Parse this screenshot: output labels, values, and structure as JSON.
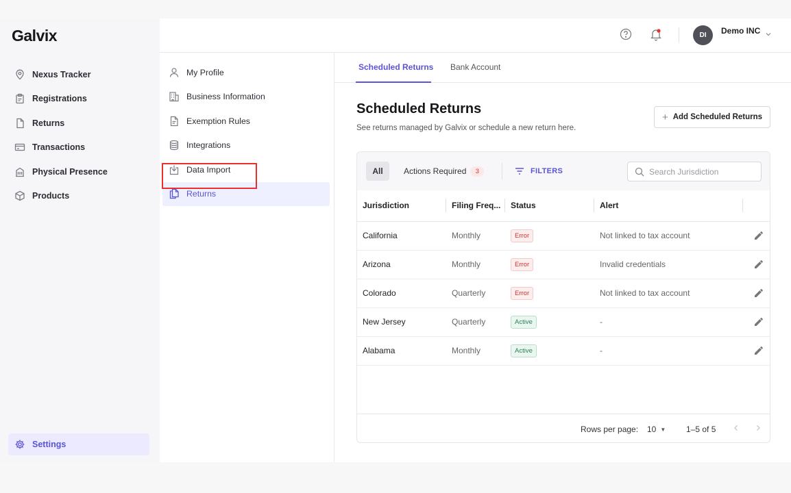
{
  "brand": {
    "name": "Galvix"
  },
  "nav": {
    "items": [
      {
        "label": "Nexus Tracker",
        "icon": "map-pin-icon"
      },
      {
        "label": "Registrations",
        "icon": "clipboard-icon"
      },
      {
        "label": "Returns",
        "icon": "document-icon"
      },
      {
        "label": "Transactions",
        "icon": "credit-card-icon"
      },
      {
        "label": "Physical Presence",
        "icon": "building-icon"
      },
      {
        "label": "Products",
        "icon": "cube-icon"
      }
    ],
    "settings_label": "Settings"
  },
  "topbar": {
    "avatar_initials": "DI",
    "company": "Demo INC"
  },
  "settings_menu": {
    "items": [
      {
        "label": "My Profile",
        "icon": "user-icon"
      },
      {
        "label": "Business Information",
        "icon": "office-icon"
      },
      {
        "label": "Exemption Rules",
        "icon": "file-text-icon"
      },
      {
        "label": "Integrations",
        "icon": "database-icon"
      },
      {
        "label": "Data Import",
        "icon": "import-icon"
      },
      {
        "label": "Returns",
        "icon": "copy-icon"
      }
    ],
    "active_index": 5
  },
  "tabs": [
    "Scheduled Returns",
    "Bank Account"
  ],
  "page": {
    "title": "Scheduled Returns",
    "subtitle": "See returns managed by Galvix or schedule a new return here.",
    "add_button": "Add Scheduled Returns"
  },
  "filters": {
    "all_label": "All",
    "actions_label": "Actions Required",
    "actions_count": "3",
    "filters_label": "FILTERS",
    "search_placeholder": "Search Jurisdiction"
  },
  "table": {
    "columns": [
      "Jurisdiction",
      "Filing Freq...",
      "Status",
      "Alert"
    ],
    "rows": [
      {
        "jurisdiction": "California",
        "frequency": "Monthly",
        "status": "Error",
        "alert": "Not linked to tax account"
      },
      {
        "jurisdiction": "Arizona",
        "frequency": "Monthly",
        "status": "Error",
        "alert": "Invalid credentials"
      },
      {
        "jurisdiction": "Colorado",
        "frequency": "Quarterly",
        "status": "Error",
        "alert": "Not linked to tax account"
      },
      {
        "jurisdiction": "New Jersey",
        "frequency": "Quarterly",
        "status": "Active",
        "alert": "-"
      },
      {
        "jurisdiction": "Alabama",
        "frequency": "Monthly",
        "status": "Active",
        "alert": "-"
      }
    ]
  },
  "pagination": {
    "rows_label": "Rows per page:",
    "rows_value": "10",
    "range": "1–5 of 5"
  },
  "colors": {
    "accent": "#5b54d6",
    "error": "#d32f2f",
    "active": "#2e7d5b",
    "highlight": "#e8312f"
  }
}
